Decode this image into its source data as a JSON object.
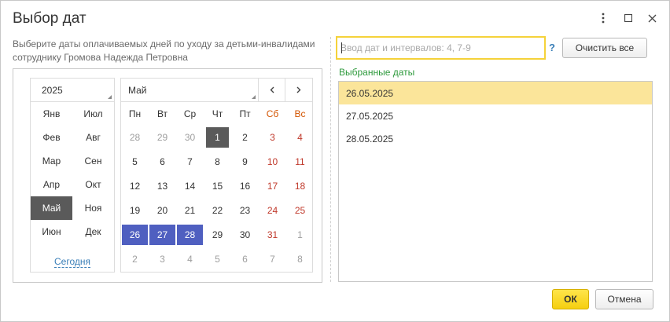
{
  "window": {
    "title": "Выбор дат",
    "controls": {
      "more_icon": "kebab-vertical",
      "maximize_icon": "square-outline",
      "close_icon": "x"
    }
  },
  "hint": "Выберите даты оплачиваемых дней по уходу за детьми-инвалидами сотруднику Громова Надежда Петровна",
  "calendar": {
    "year": "2025",
    "months": [
      "Янв",
      "Июл",
      "Фев",
      "Авг",
      "Мар",
      "Сен",
      "Апр",
      "Окт",
      "Май",
      "Ноя",
      "Июн",
      "Дек"
    ],
    "selected_month_index": 8,
    "today_link": "Сегодня",
    "month_label": "Май",
    "weekdays": [
      "Пн",
      "Вт",
      "Ср",
      "Чт",
      "Пт",
      "Сб",
      "Вс"
    ],
    "days": [
      [
        "28",
        "29",
        "30",
        "1",
        "2",
        "3",
        "4"
      ],
      [
        "5",
        "6",
        "7",
        "8",
        "9",
        "10",
        "11"
      ],
      [
        "12",
        "13",
        "14",
        "15",
        "16",
        "17",
        "18"
      ],
      [
        "19",
        "20",
        "21",
        "22",
        "23",
        "24",
        "25"
      ],
      [
        "26",
        "27",
        "28",
        "29",
        "30",
        "31",
        "1"
      ],
      [
        "2",
        "3",
        "4",
        "5",
        "6",
        "7",
        "8"
      ]
    ],
    "colors": {
      "weekend": "#c0392b",
      "weekday_header_weekend": "#d35400",
      "picked": "#4f5fc0",
      "current": "#5a5a5a"
    }
  },
  "input": {
    "placeholder": "Ввод дат и интервалов: 4, 7-9",
    "value": ""
  },
  "help_mark": "?",
  "clear_all_label": "Очистить все",
  "selected": {
    "label": "Выбранные даты",
    "items": [
      "26.05.2025",
      "27.05.2025",
      "28.05.2025"
    ],
    "active_index": 0
  },
  "footer": {
    "ok_label": "ОК",
    "cancel_label": "Отмена"
  }
}
